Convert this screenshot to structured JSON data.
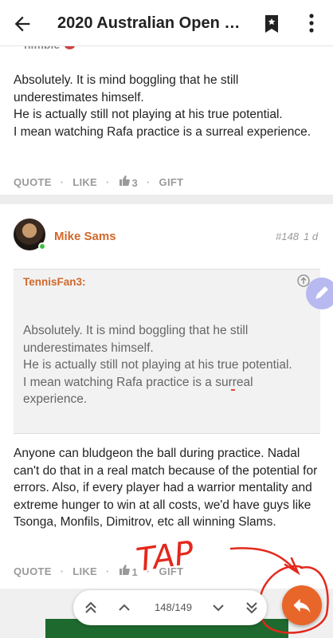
{
  "topbar": {
    "title": "2020 Australian Open R..."
  },
  "previous_post": {
    "author_partial": "nimble",
    "lines": [
      "Absolutely. It is mind boggling that he still underestimates himself.",
      "He is actually still not playing at his true potential.",
      "I mean watching Rafa practice is a surreal experience."
    ],
    "actions": {
      "quote": "QUOTE",
      "like": "LIKE",
      "likes_count": "3",
      "gift": "GIFT"
    }
  },
  "post": {
    "author": "Mike Sams",
    "number": "#148",
    "time": "1 d",
    "quote": {
      "author": "TennisFan3:",
      "lines": [
        "Absolutely. It is mind boggling that he still underestimates himself.",
        "He is actually still not playing at his true potential.",
        "I mean watching Rafa practice is a surreal experience."
      ]
    },
    "body": "Anyone can bludgeon the ball during practice. Nadal can't do that in a real match because of the potential for errors. Also, if every player had a warrior mentality and extreme hunger to win at all costs, we'd have guys like Tsonga, Monfils, Dimitrov, etc all winning Slams.",
    "actions": {
      "quote": "QUOTE",
      "like": "LIKE",
      "likes_count": "1",
      "gift": "GIFT"
    }
  },
  "annotation": {
    "text": "TAP",
    "color": "#e4281c"
  },
  "navigation": {
    "pager": "148/149"
  },
  "colors": {
    "accent": "#d0682b",
    "reply_button": "#e8662a",
    "online": "#3ec23e"
  },
  "icons": [
    "back-arrow-icon",
    "bookmark-icon",
    "more-vert-icon",
    "thumbs-up-icon",
    "arrow-up-circle-icon",
    "edit-icon",
    "double-chevron-up-icon",
    "chevron-up-icon",
    "chevron-down-icon",
    "double-chevron-down-icon",
    "reply-icon"
  ]
}
